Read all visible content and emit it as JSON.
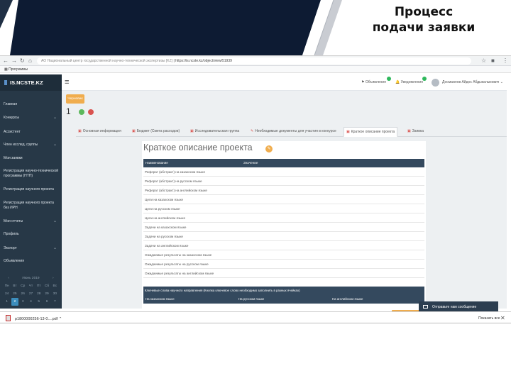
{
  "slide": {
    "title_line1": "Процесс",
    "title_line2": "подачи заявки"
  },
  "browser": {
    "address_site": "АО Национальный центр государственной научно-технической экспертизы [KZ]",
    "address_url": "https://is.ncste.kz/object/view/51939",
    "bookmark": "Программы"
  },
  "app": {
    "brand": "IS.NCSTE.KZ",
    "announcements": "Объявления",
    "notifications": "Уведомления",
    "user_name": "Досмаилов Айдос Абдыкалыкович"
  },
  "sidebar": {
    "items": [
      {
        "label": "Главная"
      },
      {
        "label": "Конкурсы"
      },
      {
        "label": "Ассистент"
      },
      {
        "label": "Член исслед. группы"
      },
      {
        "label": "Мои заявки"
      },
      {
        "label": "Регистрация научно-технической программы (НТП)"
      },
      {
        "label": "Регистрация научного проекта"
      },
      {
        "label": "Регистрация научного проекта без ИРН"
      },
      {
        "label": "Мои отчеты"
      },
      {
        "label": "Профиль"
      },
      {
        "label": "Экспорт"
      },
      {
        "label": "Объявления"
      }
    ],
    "calendar": {
      "month": "Июнь 2019",
      "weekdays": [
        "Пн",
        "Вт",
        "Ср",
        "Чт",
        "Пт",
        "Сб",
        "Вс"
      ],
      "week1": [
        "27",
        "28",
        "29",
        "30",
        "31",
        "1",
        "2"
      ],
      "week2": [
        "3",
        "4",
        "5",
        "6",
        "7",
        "8",
        "9"
      ],
      "week0": [
        "24",
        "25",
        "26",
        "27",
        "28",
        "29",
        "30"
      ],
      "week_a": [
        "1",
        "2",
        "3",
        "4",
        "5",
        "6",
        "7"
      ]
    }
  },
  "project": {
    "status": "Черновик",
    "number": "1"
  },
  "tabs": [
    {
      "label": "Основная информация"
    },
    {
      "label": "Бюджет (Смета расходов)"
    },
    {
      "label": "Исследовательская группа"
    },
    {
      "label": "Необходимые документы для участия в конкурсе"
    },
    {
      "label": "Краткое описание проекта"
    },
    {
      "label": "Заявка"
    }
  ],
  "section": {
    "title": "Краткое описание проекта",
    "col_name": "Наименование",
    "col_value": "Значение",
    "rows": [
      "Реферат (абстракт) на казахском языке",
      "Реферат (абстракт) на русском языке",
      "Реферат (абстракт) на английском языке",
      "Цели на казахском языке",
      "Цели на русском языке",
      "Цели на английском языке",
      "Задачи на казахском языке",
      "Задачи на русском языке",
      "Задачи на английском языке",
      "Ожидаемые результаты на казахском языке",
      "Ожидаемые результаты на русском языке",
      "Ожидаемые результаты на английском языке"
    ]
  },
  "keywords": {
    "title": "Ключевые слова научного направления (Кнопка ключевое слово необходимо заполнить в разных ячейках)",
    "col_kz": "На казахском языке",
    "col_ru": "На русском языке",
    "col_en": "На английском языке"
  },
  "chat": {
    "label": "Отправьте нам сообщение"
  },
  "download": {
    "file": "p1800000256-13-0....pdf",
    "show_all": "Показать все"
  }
}
